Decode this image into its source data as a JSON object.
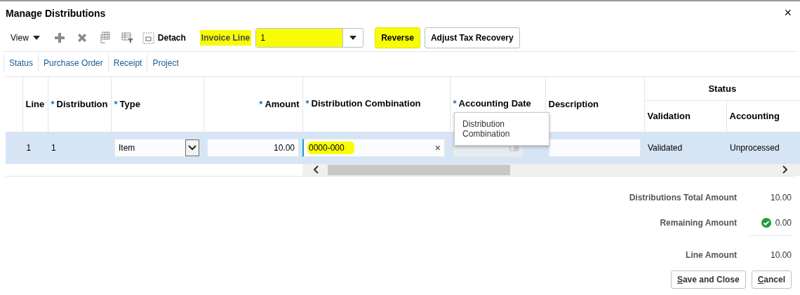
{
  "window": {
    "title": "Manage Distributions",
    "close": "×"
  },
  "toolbar": {
    "view_menu": "View",
    "detach": "Detach",
    "invoice_line": {
      "label": "Invoice Line",
      "value": "1",
      "highlighted": true
    },
    "buttons": [
      {
        "label": "Reverse",
        "highlighted": true
      },
      {
        "label": "Adjust Tax Recovery",
        "highlighted": false
      }
    ]
  },
  "links": [
    "Status",
    "Purchase Order",
    "Receipt",
    "Project"
  ],
  "table": {
    "group_header": "Status",
    "columns": [
      {
        "label": "Line"
      },
      {
        "label": "Distribution",
        "marker": "*"
      },
      {
        "label": "Type",
        "marker": "*"
      },
      {
        "label": "Amount",
        "marker": "*"
      },
      {
        "label": "Distribution Combination",
        "marker": "*"
      },
      {
        "label": "Accounting Date",
        "marker": "*"
      },
      {
        "label": "Description"
      },
      {
        "label": "Validation"
      },
      {
        "label": "Accounting"
      }
    ],
    "rows": [
      {
        "selected": true,
        "line": "1",
        "distribution": "1",
        "type": "Item",
        "amount": "10.00",
        "distribution_combination": "0000-000",
        "combination_highlighted": true,
        "clear_glyph": "×",
        "validation": "Validated",
        "accounting": "Unprocessed"
      }
    ]
  },
  "tooltip": {
    "text": "Distribution Combination"
  },
  "summary": [
    {
      "kind": "plain",
      "label": "Distributions Total Amount",
      "value": "10.00"
    },
    {
      "kind": "ok",
      "label": "Remaining Amount",
      "value": "0.00"
    },
    {
      "kind": "total",
      "label": "Line Amount",
      "value": "10.00"
    }
  ],
  "footer_buttons": [
    "Save and Close",
    "Cancel"
  ]
}
